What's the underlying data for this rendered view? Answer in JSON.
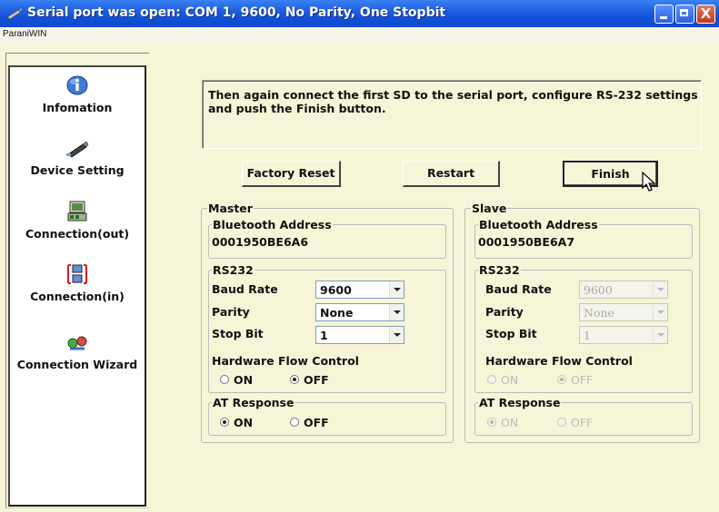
{
  "window": {
    "title": "Serial port was open: COM 1, 9600, No Parity, One Stopbit",
    "menu_label": "ParaniWIN",
    "close_glyph": "X"
  },
  "sidebar": {
    "items": [
      {
        "label": "Infomation",
        "icon": "info-icon"
      },
      {
        "label": "Device Setting",
        "icon": "device-icon"
      },
      {
        "label": "Connection(out)",
        "icon": "connection-out-icon"
      },
      {
        "label": "Connection(in)",
        "icon": "connection-in-icon"
      },
      {
        "label": "Connection Wizard",
        "icon": "wizard-icon"
      }
    ]
  },
  "message": "Then again connect the first SD to the serial port, configure RS-232 settings and push the Finish button.",
  "buttons": {
    "factory_reset": "Factory Reset",
    "restart": "Restart",
    "finish": "Finish"
  },
  "master": {
    "legend": "Master",
    "bt_legend": "Bluetooth Address",
    "bt_address": "0001950BE6A6",
    "rs232_legend": "RS232",
    "baud_label": "Baud Rate",
    "baud_value": "9600",
    "parity_label": "Parity",
    "parity_value": "None",
    "stop_label": "Stop Bit",
    "stop_value": "1",
    "hw_label": "Hardware Flow Control",
    "hw_on": "ON",
    "hw_off": "OFF",
    "hw_selected": "OFF",
    "at_legend": "AT Response",
    "at_on": "ON",
    "at_off": "OFF",
    "at_selected": "ON"
  },
  "slave": {
    "legend": "Slave",
    "bt_legend": "Bluetooth Address",
    "bt_address": "0001950BE6A7",
    "rs232_legend": "RS232",
    "baud_label": "Baud Rate",
    "baud_value": "9600",
    "parity_label": "Parity",
    "parity_value": "None",
    "stop_label": "Stop Bit",
    "stop_value": "1",
    "hw_label": "Hardware Flow Control",
    "hw_on": "ON",
    "hw_off": "OFF",
    "hw_selected": "OFF",
    "at_legend": "AT Response",
    "at_on": "ON",
    "at_off": "OFF",
    "at_selected": "ON",
    "disabled": true
  },
  "colors": {
    "titlebar": "#1f5fe0",
    "client_bg": "#f7f5d8"
  }
}
